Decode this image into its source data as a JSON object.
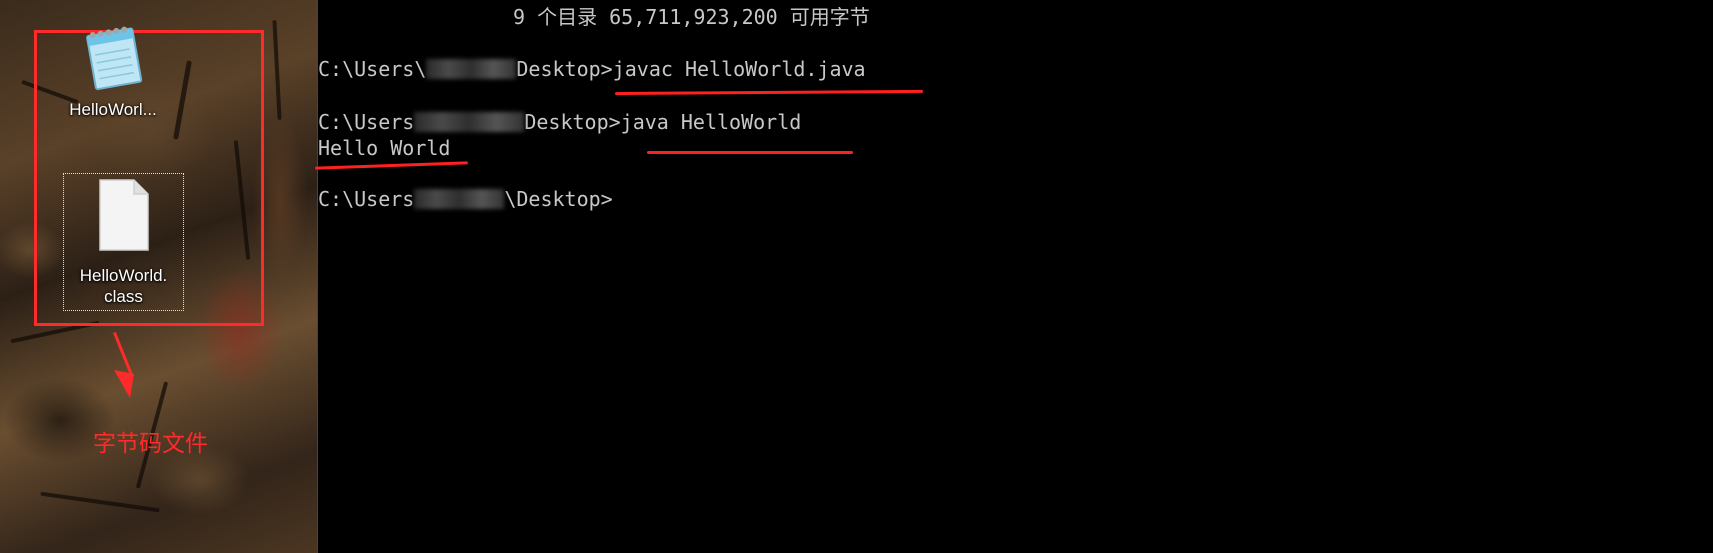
{
  "desktop": {
    "icons": [
      {
        "name": "notepad-file",
        "label": "HelloWorl..."
      },
      {
        "name": "class-file",
        "label_line1": "HelloWorld.",
        "label_line2": "class"
      }
    ],
    "caption": "字节码文件",
    "colors": {
      "annotation_red": "#ff2a2a"
    }
  },
  "console": {
    "top_line": "9 个目录 65,711,923,200 可用字节",
    "prompt_prefix": "C:\\Users",
    "prompt_sep": "\\",
    "prompt_suffix": "Desktop>",
    "commands": [
      {
        "text": "javac HelloWorld.java"
      },
      {
        "text": "java HelloWorld"
      }
    ],
    "output": "Hello World",
    "text_color": "#c8c8c8"
  }
}
